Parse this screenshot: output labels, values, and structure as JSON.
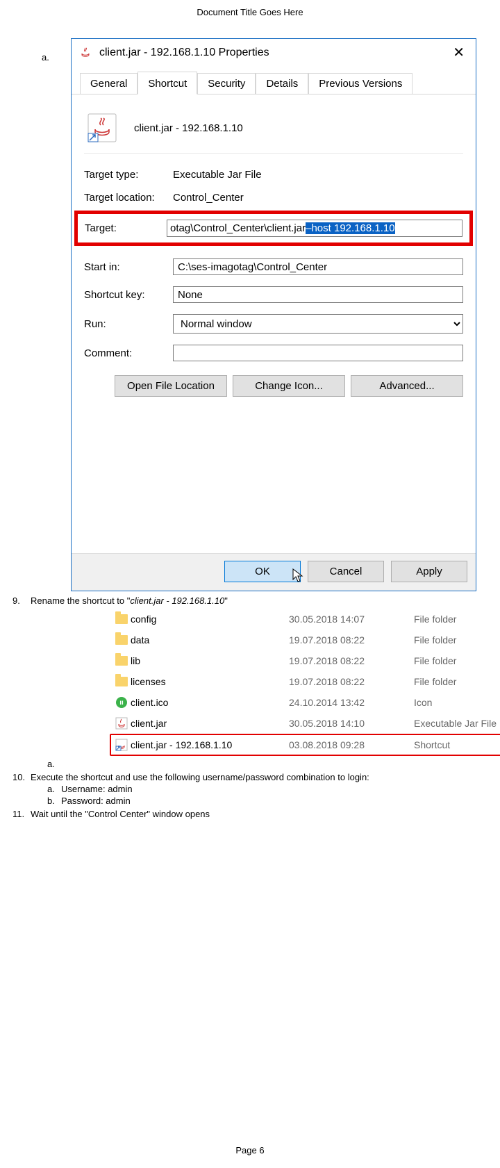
{
  "doc": {
    "title": "Document Title Goes Here",
    "page": "Page 6"
  },
  "props": {
    "title": "client.jar - 192.168.1.10 Properties",
    "tabs": {
      "general": "General",
      "shortcut": "Shortcut",
      "security": "Security",
      "details": "Details",
      "previous": "Previous Versions"
    },
    "file_label": "client.jar - 192.168.1.10",
    "labels": {
      "target_type": "Target type:",
      "target_location": "Target location:",
      "target": "Target:",
      "start_in": "Start in:",
      "shortcut_key": "Shortcut key:",
      "run": "Run:",
      "comment": "Comment:"
    },
    "values": {
      "target_type": "Executable Jar File",
      "target_location": "Control_Center",
      "target_prefix": "otag\\Control_Center\\client.jar",
      "target_selected": "–host 192.168.1.10",
      "start_in": "C:\\ses-imagotag\\Control_Center",
      "shortcut_key": "None",
      "run": "Normal window",
      "comment": ""
    },
    "buttons": {
      "open_loc": "Open File Location",
      "change_icon": "Change Icon...",
      "advanced": "Advanced...",
      "ok": "OK",
      "cancel": "Cancel",
      "apply": "Apply"
    }
  },
  "steps": {
    "s9_prefix": "Rename the shortcut to \"",
    "s9_italic": "client.jar - 192.168.1.10",
    "s9_suffix": "\"",
    "s10": "Execute the shortcut and use the following username/password combination to login:",
    "s10a": "Username: admin",
    "s10b": "Password: admin",
    "s11": "Wait until the \"Control Center\" window opens"
  },
  "explorer": [
    {
      "icon": "folder",
      "name": "config",
      "date": "30.05.2018 14:07",
      "type": "File folder",
      "hl": false
    },
    {
      "icon": "folder",
      "name": "data",
      "date": "19.07.2018 08:22",
      "type": "File folder",
      "hl": false
    },
    {
      "icon": "folder",
      "name": "lib",
      "date": "19.07.2018 08:22",
      "type": "File folder",
      "hl": false
    },
    {
      "icon": "folder",
      "name": "licenses",
      "date": "19.07.2018 08:22",
      "type": "File folder",
      "hl": false
    },
    {
      "icon": "ico",
      "name": "client.ico",
      "date": "24.10.2014 13:42",
      "type": "Icon",
      "hl": false
    },
    {
      "icon": "jar",
      "name": "client.jar",
      "date": "30.05.2018 14:10",
      "type": "Executable Jar File",
      "hl": false
    },
    {
      "icon": "shortcut",
      "name": "client.jar - 192.168.1.10",
      "date": "03.08.2018 09:28",
      "type": "Shortcut",
      "hl": true
    }
  ]
}
